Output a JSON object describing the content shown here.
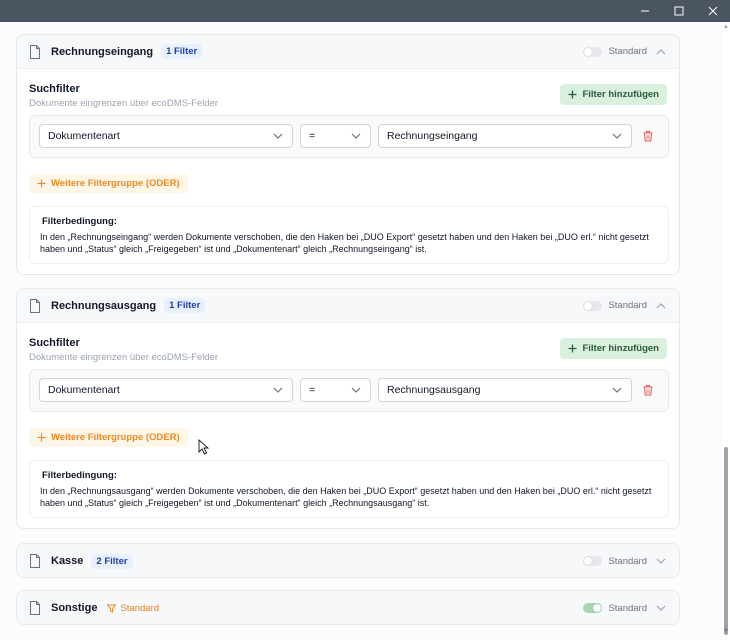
{
  "window": {
    "controls": [
      "minimize",
      "maximize",
      "close"
    ]
  },
  "cards": [
    {
      "title": "Rechnungseingang",
      "badge": "1 Filter",
      "toggle_label": "Standard",
      "toggle_on": false,
      "expanded": true,
      "search": {
        "title": "Suchfilter",
        "subtitle": "Dokumente eingrenzen über ecoDMS-Felder",
        "add_label": "Filter hinzufügen",
        "field": "Dokumentenart",
        "operator": "=",
        "value": "Rechnungseingang",
        "or_label": "Weitere Filtergruppe (ODER)"
      },
      "condition": {
        "title": "Filterbedingung:",
        "text": "In den „Rechnungseingang“ werden Dokumente verschoben, die den Haken bei „DUO Export“ gesetzt haben und den Haken bei „DUO erl.“ nicht gesetzt haben und „Status“ gleich „Freigegeben“ ist und „Dokumentenart“ gleich „Rechnungseingang“ ist."
      }
    },
    {
      "title": "Rechnungsausgang",
      "badge": "1 Filter",
      "toggle_label": "Standard",
      "toggle_on": false,
      "expanded": true,
      "search": {
        "title": "Suchfilter",
        "subtitle": "Dokumente eingrenzen über ecoDMS-Felder",
        "add_label": "Filter hinzufügen",
        "field": "Dokumentenart",
        "operator": "=",
        "value": "Rechnungsausgang",
        "or_label": "Weitere Filtergruppe (ODER)"
      },
      "condition": {
        "title": "Filterbedingung:",
        "text": "In den „Rechnungsausgang“ werden Dokumente verschoben, die den Haken bei „DUO Export“ gesetzt haben und den Haken bei „DUO erl.“ nicht gesetzt haben und „Status“ gleich „Freigegeben“ ist und „Dokumentenart“ gleich „Rechnungsausgang“ ist."
      }
    },
    {
      "title": "Kasse",
      "badge": "2 Filter",
      "toggle_label": "Standard",
      "toggle_on": false,
      "expanded": false
    },
    {
      "title": "Sonstige",
      "standard_badge": "Standard",
      "toggle_label": "Standard",
      "toggle_on": true,
      "expanded": false
    }
  ],
  "colors": {
    "titlebar": "#4a5561",
    "accent_green": "#d9f0de",
    "accent_orange": "#ec8b22",
    "badge_blue": "#1e40af",
    "trash_red": "#e35757"
  },
  "icons": {
    "card": "document-icon",
    "add": "plus-icon",
    "delete": "trash-icon",
    "standard": "filter-funnel-icon",
    "expand": "chevron-icon"
  }
}
